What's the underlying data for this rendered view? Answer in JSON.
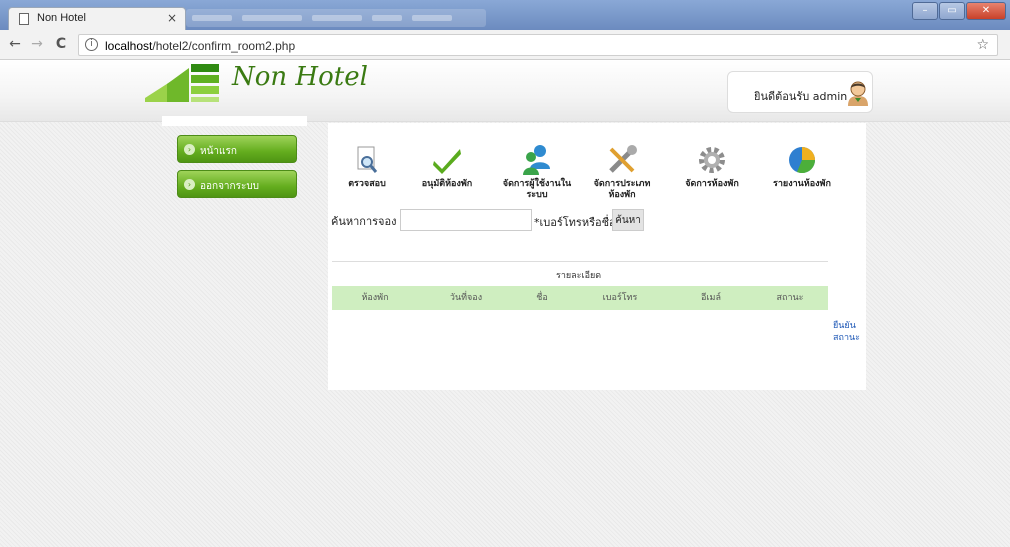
{
  "browser": {
    "tab_title": "Non Hotel",
    "tab_close": "×",
    "url_host": "localhost",
    "url_path": "/hotel2/confirm_room2.php",
    "back": "←",
    "forward": "→",
    "reload": "C",
    "info": "i",
    "star": "☆"
  },
  "header": {
    "logo_text": "Non Hotel",
    "welcome": "ยินดีต้อนรับ admin",
    "colors": {
      "logo": "#3a7a12"
    }
  },
  "sidebar": {
    "items": [
      {
        "label": "หน้าแรก"
      },
      {
        "label": "ออกจากระบบ"
      }
    ]
  },
  "nav": {
    "items": [
      {
        "label": "ตรวจสอบ",
        "icon": "magnifier-document-icon"
      },
      {
        "label": "อนุมัติห้องพัก",
        "icon": "checkmark-icon"
      },
      {
        "label": "จัดการผู้ใช้งานในระบบ",
        "icon": "users-icon"
      },
      {
        "label": "จัดการประเภทห้องพัก",
        "icon": "tools-icon"
      },
      {
        "label": "จัดการห้องพัก",
        "icon": "gear-icon"
      },
      {
        "label": "รายงานห้องพัก",
        "icon": "pie-chart-icon"
      }
    ]
  },
  "search": {
    "label": "ค้นหาการจอง",
    "value": "",
    "hint": "*เบอร์โทรหรือชื่อ",
    "button": "ค้นหา"
  },
  "table": {
    "title": "รายละเอียด",
    "headers": [
      "ห้องพัก",
      "วันที่จอง",
      "ชื่อ",
      "เบอร์โทร",
      "อีเมล์",
      "สถานะ"
    ],
    "confirm_link_line1": "ยืนยัน",
    "confirm_link_line2": "สถานะ"
  }
}
